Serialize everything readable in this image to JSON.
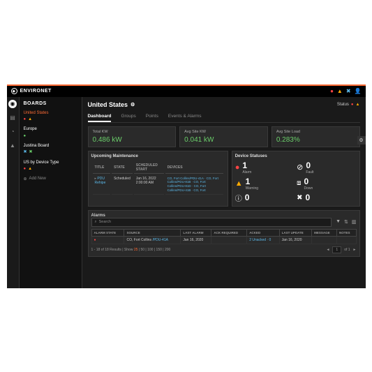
{
  "brand": "ENVIRONET",
  "sidebar": {
    "title": "BOARDS",
    "items": [
      {
        "label": "United States",
        "active": true
      },
      {
        "label": "Europe"
      },
      {
        "label": "Justina Board"
      },
      {
        "label": "US by Device Type"
      }
    ],
    "addnew": "Add New"
  },
  "page": {
    "title": "United States",
    "status_label": "Status"
  },
  "tabs": [
    "Dashboard",
    "Groups",
    "Points",
    "Events & Alarms"
  ],
  "kpis": [
    {
      "label": "Total KW",
      "value": "0.486 kW"
    },
    {
      "label": "Avg Site KW",
      "value": "0.041 kW"
    },
    {
      "label": "Avg Site Load",
      "value": "0.283%"
    }
  ],
  "upcoming": {
    "title": "Upcoming Maintenance",
    "headers": [
      "TITLE",
      "STATE",
      "SCHEDULED START",
      "DEVICES"
    ],
    "row": {
      "title": "PDU Rehipe",
      "state": "Scheduled",
      "start": "Jan 16, 2022 2:00:00 AM",
      "devices": "CO, Fort Collins/PDU-41A · CO, Fort Collins/PDU-81B · CO, Fort Collins/PDU-81D · CO, Fort Collins/PDU-41B · CO, Fort"
    }
  },
  "devstat": {
    "title": "Device Statuses",
    "items": [
      {
        "icon": "alarm",
        "count": "1",
        "label": "Alarm",
        "color": "red"
      },
      {
        "icon": "fault",
        "count": "0",
        "label": "Fault",
        "color": "white"
      },
      {
        "icon": "warn",
        "count": "1",
        "label": "Warning",
        "color": "yellow"
      },
      {
        "icon": "down",
        "count": "0",
        "label": "Down",
        "color": "white"
      },
      {
        "icon": "maint",
        "count": "0",
        "label": "",
        "color": "white"
      },
      {
        "icon": "maint2",
        "count": "0",
        "label": "",
        "color": "white"
      }
    ]
  },
  "alarms": {
    "title": "Alarms",
    "search_ph": "Search",
    "headers": [
      "ALARM STATE",
      "SOURCE",
      "LAST ALARM",
      "ACK REQUIRED",
      "ACKED",
      "LAST UPDATE",
      "MESSAGE",
      "NOTES"
    ],
    "row": {
      "source_text": "CO, Fort Collins",
      "source_link": "/PDU-41A",
      "last_alarm": "Jan 16, 2020",
      "acked": "2 Unacked · 0",
      "last_update": "Jan 16, 2020"
    },
    "pager_text": "1 - 18 of 18 Results | Show",
    "pager_active": "25",
    "pager_rest": "| 50 | 100 | 150 | 200",
    "page_of": "of 1",
    "page_cur": "1"
  }
}
